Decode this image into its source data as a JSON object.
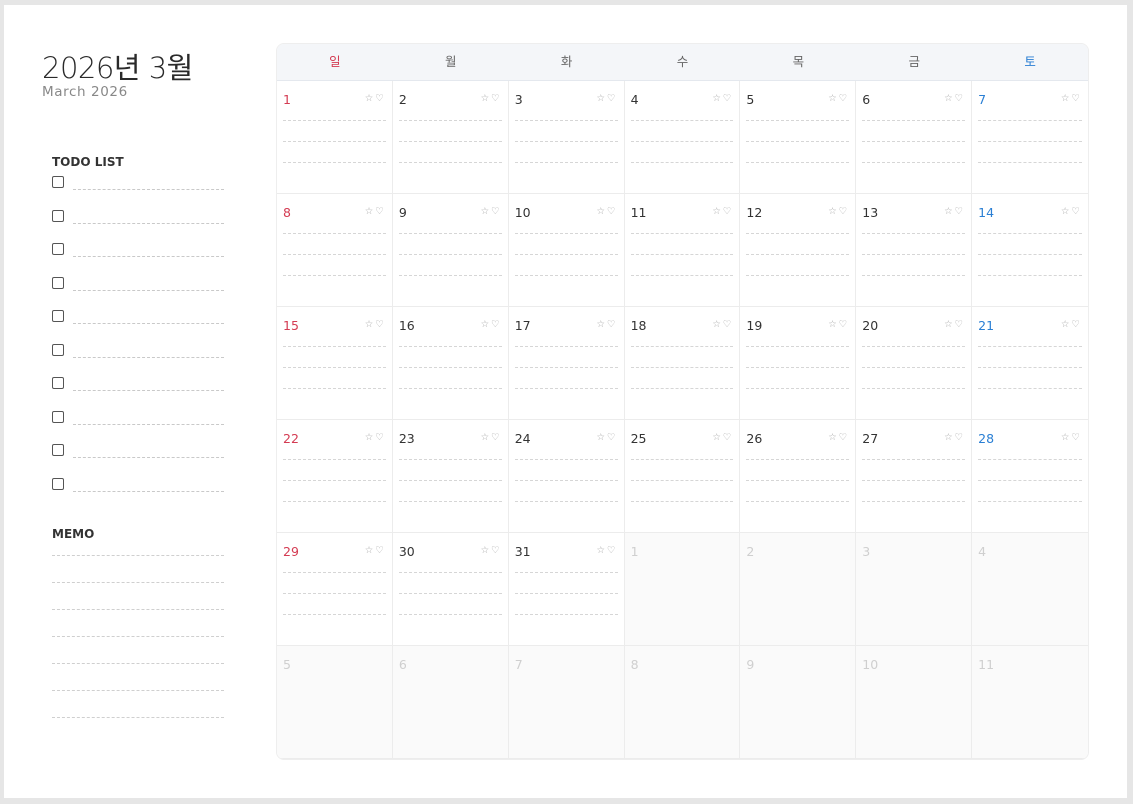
{
  "header": {
    "title": "2026년 3월",
    "subtitle": "March 2026"
  },
  "todo": {
    "label": "TODO LIST",
    "count": 10
  },
  "memo": {
    "label": "MEMO",
    "lines": 7
  },
  "icons": {
    "star": "☆",
    "heart": "♡",
    "star_name": "star-icon",
    "heart_name": "heart-icon"
  },
  "colors": {
    "sunday": "#d43b52",
    "saturday": "#2a7fd4",
    "muted": "#cfcfcf"
  },
  "weekdays": [
    "일",
    "월",
    "화",
    "수",
    "목",
    "금",
    "토"
  ],
  "weeks": [
    [
      {
        "d": "1"
      },
      {
        "d": "2"
      },
      {
        "d": "3"
      },
      {
        "d": "4"
      },
      {
        "d": "5"
      },
      {
        "d": "6"
      },
      {
        "d": "7"
      }
    ],
    [
      {
        "d": "8"
      },
      {
        "d": "9"
      },
      {
        "d": "10"
      },
      {
        "d": "11"
      },
      {
        "d": "12"
      },
      {
        "d": "13"
      },
      {
        "d": "14"
      }
    ],
    [
      {
        "d": "15"
      },
      {
        "d": "16"
      },
      {
        "d": "17"
      },
      {
        "d": "18"
      },
      {
        "d": "19"
      },
      {
        "d": "20"
      },
      {
        "d": "21"
      }
    ],
    [
      {
        "d": "22"
      },
      {
        "d": "23"
      },
      {
        "d": "24"
      },
      {
        "d": "25"
      },
      {
        "d": "26"
      },
      {
        "d": "27"
      },
      {
        "d": "28"
      }
    ],
    [
      {
        "d": "29"
      },
      {
        "d": "30"
      },
      {
        "d": "31"
      },
      {
        "d": "1",
        "other": true
      },
      {
        "d": "2",
        "other": true
      },
      {
        "d": "3",
        "other": true
      },
      {
        "d": "4",
        "other": true
      }
    ],
    [
      {
        "d": "5",
        "other": true
      },
      {
        "d": "6",
        "other": true
      },
      {
        "d": "7",
        "other": true
      },
      {
        "d": "8",
        "other": true
      },
      {
        "d": "9",
        "other": true
      },
      {
        "d": "10",
        "other": true
      },
      {
        "d": "11",
        "other": true
      }
    ]
  ]
}
